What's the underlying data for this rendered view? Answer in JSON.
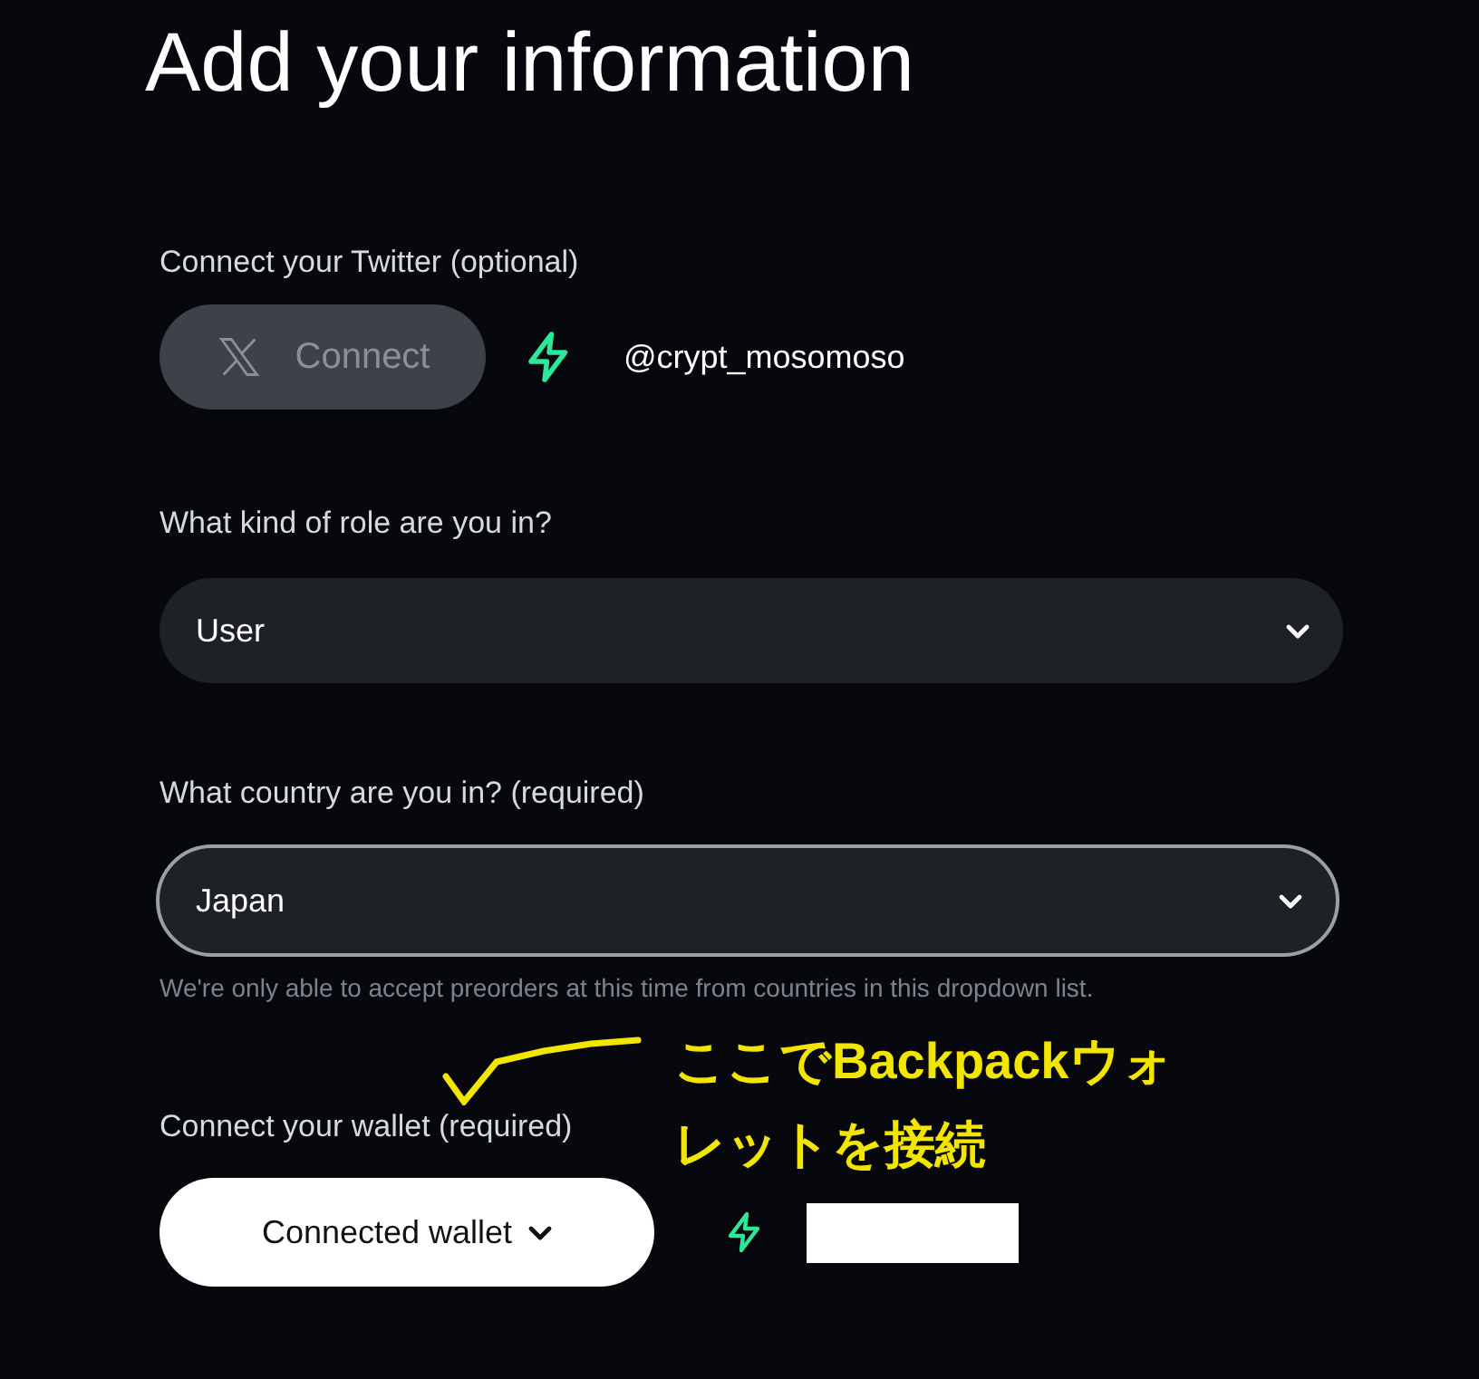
{
  "title": "Add your information",
  "twitter": {
    "label": "Connect your Twitter (optional)",
    "button": "Connect",
    "disabled": true,
    "connected": true,
    "handle": "@crypt_mosomoso"
  },
  "role": {
    "label": "What kind of role are you in?",
    "value": "User",
    "focused": false
  },
  "country": {
    "label": "What country are you in? (required)",
    "value": "Japan",
    "focused": true,
    "hint": "We're only able to accept preorders at this time from countries in this dropdown list."
  },
  "wallet": {
    "label": "Connect your wallet (required)",
    "button": "Connected wallet",
    "connected": true
  },
  "annotation": {
    "lines": [
      "ここでBackpackウォ",
      "レットを接続"
    ]
  }
}
